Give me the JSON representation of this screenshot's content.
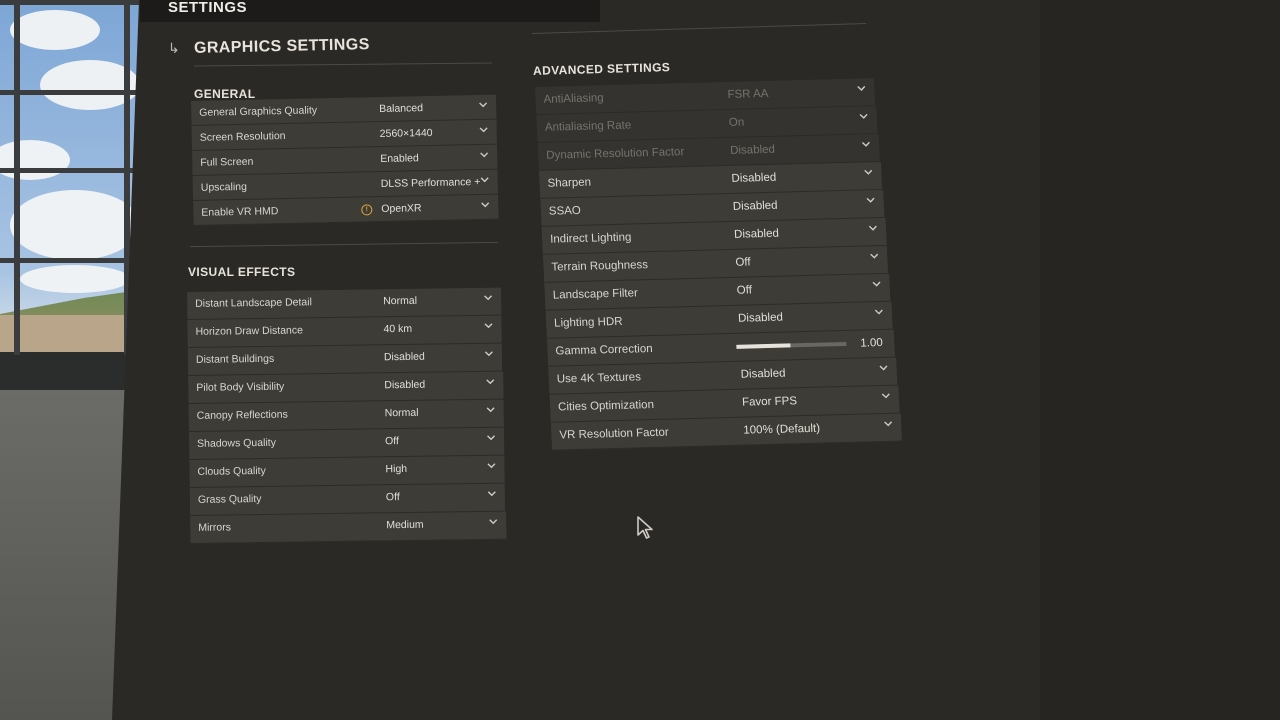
{
  "header": {
    "title": "SETTINGS"
  },
  "graphics": {
    "title": "GRAPHICS SETTINGS"
  },
  "general": {
    "title": "GENERAL",
    "rows": [
      {
        "label": "General Graphics Quality",
        "value": "Balanced"
      },
      {
        "label": "Screen Resolution",
        "value": "2560×1440"
      },
      {
        "label": "Full Screen",
        "value": "Enabled"
      },
      {
        "label": "Upscaling",
        "value": "DLSS Performance +"
      },
      {
        "label": "Enable VR HMD",
        "value": "OpenXR",
        "warning_icon": "warning-icon"
      }
    ]
  },
  "visual": {
    "title": "VISUAL EFFECTS",
    "rows": [
      {
        "label": "Distant Landscape Detail",
        "value": "Normal"
      },
      {
        "label": "Horizon Draw Distance",
        "value": "40 km"
      },
      {
        "label": "Distant Buildings",
        "value": "Disabled"
      },
      {
        "label": "Pilot Body Visibility",
        "value": "Disabled"
      },
      {
        "label": "Canopy Reflections",
        "value": "Normal"
      },
      {
        "label": "Shadows Quality",
        "value": "Off"
      },
      {
        "label": "Clouds Quality",
        "value": "High"
      },
      {
        "label": "Grass Quality",
        "value": "Off"
      },
      {
        "label": "Mirrors",
        "value": "Medium"
      }
    ]
  },
  "advanced": {
    "title": "ADVANCED SETTINGS",
    "rows": [
      {
        "label": "AntiAliasing",
        "value": "FSR AA",
        "disabled": true
      },
      {
        "label": "Antialiasing Rate",
        "value": "On",
        "disabled": true
      },
      {
        "label": "Dynamic Resolution Factor",
        "value": "Disabled",
        "disabled": true
      },
      {
        "label": "Sharpen",
        "value": "Disabled"
      },
      {
        "label": "SSAO",
        "value": "Disabled"
      },
      {
        "label": "Indirect Lighting",
        "value": "Disabled"
      },
      {
        "label": "Terrain Roughness",
        "value": "Off"
      },
      {
        "label": "Landscape Filter",
        "value": "Off"
      },
      {
        "label": "Lighting HDR",
        "value": "Disabled"
      },
      {
        "label": "Gamma Correction",
        "value": "1.00",
        "slider_fraction": 0.49
      },
      {
        "label": "Use 4K Textures",
        "value": "Disabled"
      },
      {
        "label": "Cities Optimization",
        "value": "Favor FPS"
      },
      {
        "label": "VR Resolution Factor",
        "value": "100% (Default)"
      }
    ]
  },
  "colors": {
    "panel": "#2a2925",
    "row": "#3d3c37",
    "text": "#d9d6ce",
    "warning": "#d9a23a"
  },
  "icons": {
    "dropdown": "chevron-down-icon",
    "section_arrow": "corner-arrow-icon",
    "cursor": "mouse-pointer-icon"
  }
}
